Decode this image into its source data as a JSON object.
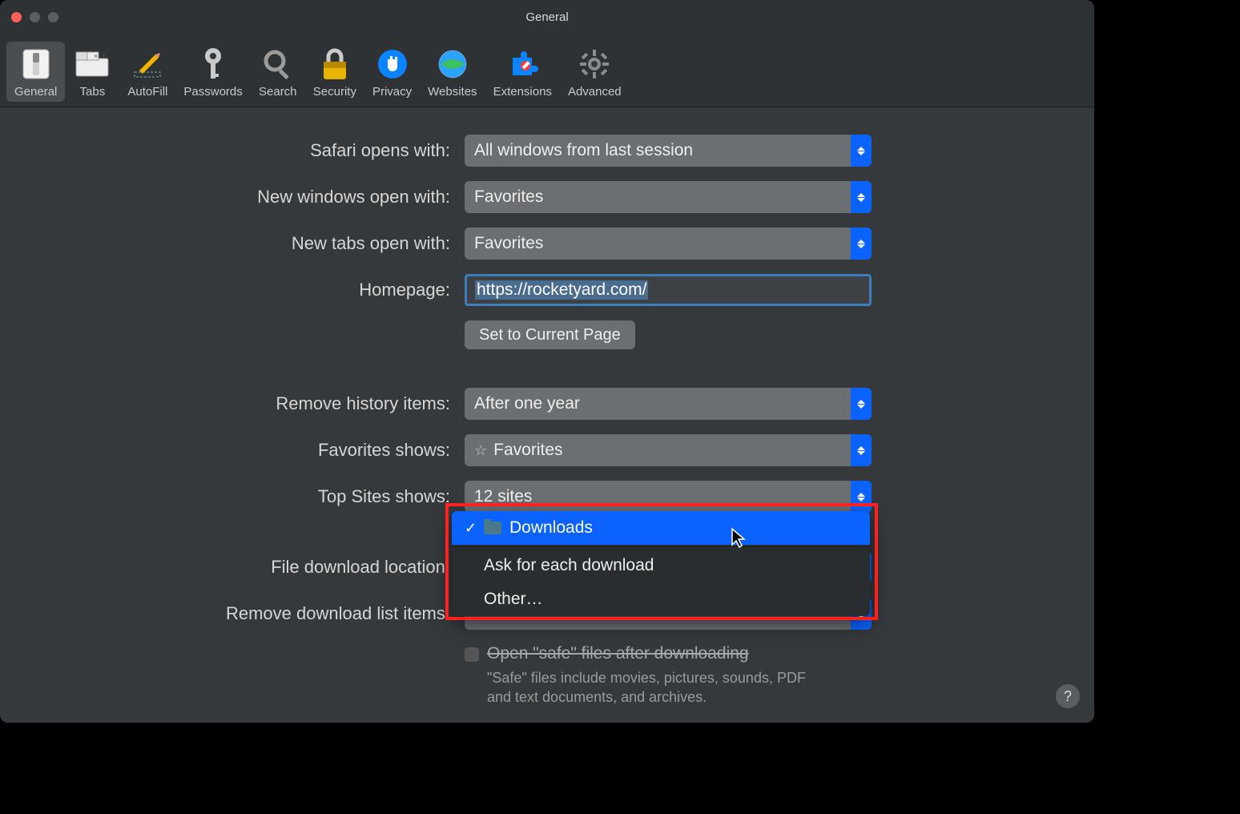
{
  "window": {
    "title": "General"
  },
  "toolbar": {
    "items": [
      {
        "id": "general",
        "label": "General"
      },
      {
        "id": "tabs",
        "label": "Tabs"
      },
      {
        "id": "autofill",
        "label": "AutoFill"
      },
      {
        "id": "passwords",
        "label": "Passwords"
      },
      {
        "id": "search",
        "label": "Search"
      },
      {
        "id": "security",
        "label": "Security"
      },
      {
        "id": "privacy",
        "label": "Privacy"
      },
      {
        "id": "websites",
        "label": "Websites"
      },
      {
        "id": "extensions",
        "label": "Extensions"
      },
      {
        "id": "advanced",
        "label": "Advanced"
      }
    ],
    "active": "general"
  },
  "rows": {
    "safari_opens_label": "Safari opens with:",
    "safari_opens_value": "All windows from last session",
    "new_windows_label": "New windows open with:",
    "new_windows_value": "Favorites",
    "new_tabs_label": "New tabs open with:",
    "new_tabs_value": "Favorites",
    "homepage_label": "Homepage:",
    "homepage_value": "https://rocketyard.com/",
    "set_current_btn": "Set to Current Page",
    "remove_history_label": "Remove history items:",
    "remove_history_value": "After one year",
    "favorites_shows_label": "Favorites shows:",
    "favorites_shows_value": "Favorites",
    "top_sites_label": "Top Sites shows:",
    "top_sites_value": "12 sites",
    "download_loc_label": "File download location:",
    "remove_dl_label": "Remove download list items:",
    "open_safe_label": "Open \"safe\" files after downloading",
    "open_safe_help": "\"Safe\" files include movies, pictures, sounds, PDF and text documents, and archives."
  },
  "download_menu": {
    "selected": "Downloads",
    "items": [
      {
        "label": "Downloads",
        "checked": true,
        "icon": "folder"
      },
      {
        "sep": true
      },
      {
        "label": "Ask for each download"
      },
      {
        "label": "Other…"
      }
    ]
  }
}
